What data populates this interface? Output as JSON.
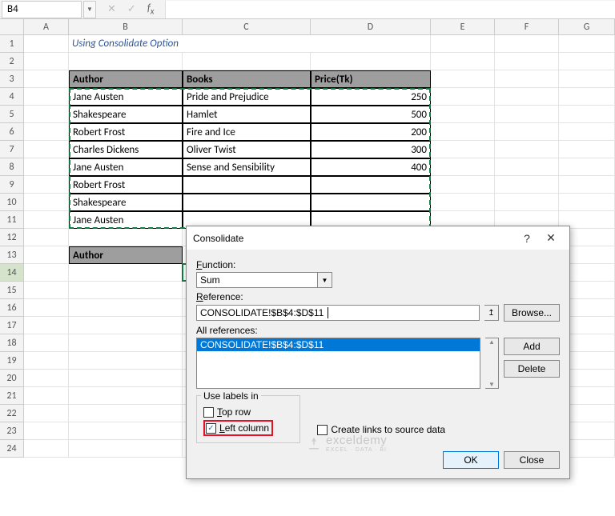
{
  "namebox": "B4",
  "columns": [
    "A",
    "B",
    "C",
    "D",
    "E",
    "F",
    "G"
  ],
  "row_numbers": [
    1,
    2,
    3,
    4,
    5,
    6,
    7,
    8,
    9,
    10,
    11,
    12,
    13,
    14,
    15,
    16,
    17,
    18,
    19,
    20,
    21,
    22,
    23,
    24
  ],
  "title": "Using Consolidate Option",
  "headers": {
    "author": "Author",
    "books": "Books",
    "price": "Price(Tk)"
  },
  "data_rows": [
    {
      "author": "Jane Austen",
      "books": "Pride and Prejudice",
      "price": 250
    },
    {
      "author": "Shakespeare",
      "books": "Hamlet",
      "price": 500
    },
    {
      "author": "Robert Frost",
      "books": "Fire and Ice",
      "price": 200
    },
    {
      "author": "Charles Dickens",
      "books": "Oliver Twist",
      "price": 300
    },
    {
      "author": "Jane Austen",
      "books": "Sense and Sensibility",
      "price": 400
    },
    {
      "author": "Robert Frost",
      "books": "",
      "price": ""
    },
    {
      "author": "Shakespeare",
      "books": "",
      "price": ""
    },
    {
      "author": "Jane Austen",
      "books": "",
      "price": ""
    }
  ],
  "second_header": {
    "author": "Author"
  },
  "dialog": {
    "title": "Consolidate",
    "function_label": "Function:",
    "function_value": "Sum",
    "reference_label": "Reference:",
    "reference_value": "CONSOLIDATE!$B$4:$D$11",
    "browse": "Browse...",
    "allrefs_label": "All references:",
    "allrefs_items": [
      "CONSOLIDATE!$B$4:$D$11"
    ],
    "add": "Add",
    "delete": "Delete",
    "uselabels": "Use labels in",
    "toprow": "Top row",
    "leftcol": "Left column",
    "createlinks": "Create links to source data",
    "ok": "OK",
    "close": "Close"
  },
  "watermark": {
    "brand": "exceldemy",
    "sub": "EXCEL · DATA · BI"
  },
  "chart_data": {
    "type": "table",
    "columns": [
      "Author",
      "Books",
      "Price(Tk)"
    ],
    "rows": [
      [
        "Jane Austen",
        "Pride and Prejudice",
        250
      ],
      [
        "Shakespeare",
        "Hamlet",
        500
      ],
      [
        "Robert Frost",
        "Fire and Ice",
        200
      ],
      [
        "Charles Dickens",
        "Oliver Twist",
        300
      ],
      [
        "Jane Austen",
        "Sense and Sensibility",
        400
      ]
    ]
  }
}
